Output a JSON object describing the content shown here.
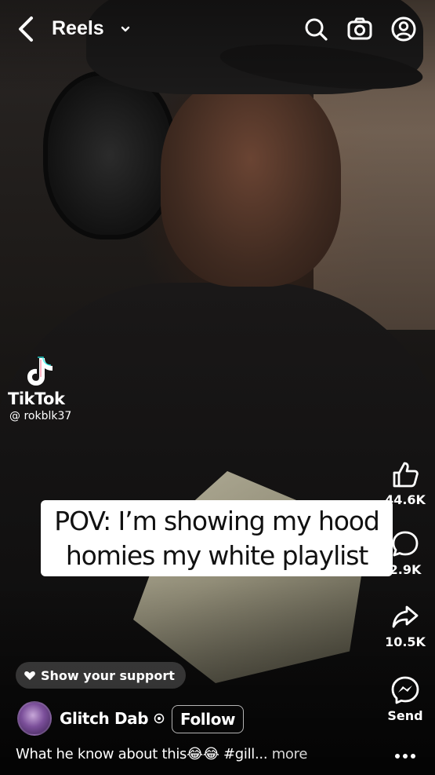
{
  "topbar": {
    "title": "Reels",
    "icons": [
      "back-chevron-icon",
      "chevron-down-icon",
      "search-icon",
      "camera-icon",
      "profile-icon"
    ]
  },
  "watermark": {
    "brand": "TikTok",
    "handle": "@ rokblk37"
  },
  "caption": {
    "line1": "POV: I’m showing my hood",
    "line2": "homies my white playlist"
  },
  "actions": {
    "like_count": "44.6K",
    "comment_count": "2.9K",
    "share_count": "10.5K",
    "send_label": "Send"
  },
  "support": {
    "label": "Show your support"
  },
  "author": {
    "name": "Glitch Dab",
    "follow_label": "Follow"
  },
  "description": {
    "text": "What he know about this😂😂 #gill...",
    "more": " more"
  },
  "colors": {
    "background": "#000000",
    "caption_bg": "#ffffff",
    "caption_text": "#111111",
    "text": "#ffffff"
  }
}
